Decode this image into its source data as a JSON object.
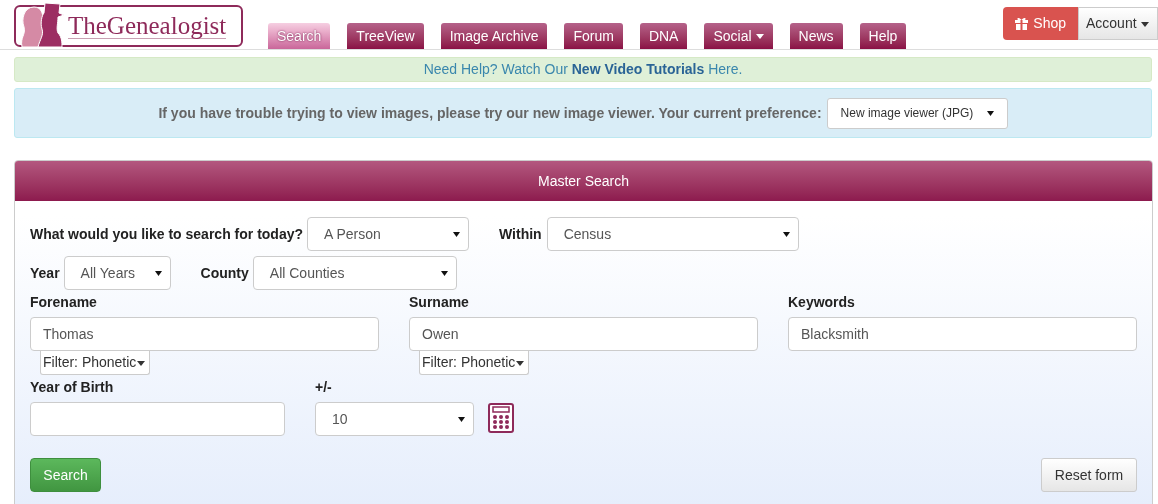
{
  "logo": {
    "text": "TheGenealogist"
  },
  "nav_tabs": [
    {
      "label": "Search",
      "selected": true,
      "caret": false
    },
    {
      "label": "TreeView",
      "selected": false,
      "caret": false
    },
    {
      "label": "Image Archive",
      "selected": false,
      "caret": false
    },
    {
      "label": "Forum",
      "selected": false,
      "caret": false
    },
    {
      "label": "DNA",
      "selected": false,
      "caret": false
    },
    {
      "label": "Social",
      "selected": false,
      "caret": true
    },
    {
      "label": "News",
      "selected": false,
      "caret": false
    },
    {
      "label": "Help",
      "selected": false,
      "caret": false
    }
  ],
  "shop_button": "Shop",
  "account_button": "Account",
  "help_banner": "Need Help? Watch Our **New Video Tutorials** Here.",
  "viewer_notice": {
    "text": "If you have trouble trying to view images, please try our new image viewer. Your current preference:",
    "value": "New image viewer (JPG)"
  },
  "panel": {
    "title": "Master Search",
    "search_for": {
      "label": "What would you like to search for today?",
      "value": "A Person"
    },
    "within": {
      "label": "Within",
      "value": "Census"
    },
    "year": {
      "label": "Year",
      "value": "All Years"
    },
    "county": {
      "label": "County",
      "value": "All Counties"
    },
    "name_fields": [
      {
        "label": "Forename",
        "value": "Thomas",
        "filter": "Filter: Phonetic"
      },
      {
        "label": "Surname",
        "value": "Owen",
        "filter": "Filter: Phonetic"
      },
      {
        "label": "Keywords",
        "value": "Blacksmith"
      }
    ],
    "year_of_birth": {
      "label": "Year of Birth"
    },
    "range": {
      "label": "+/-",
      "value": "10"
    },
    "search_button": "Search",
    "reset_button": "Reset form"
  }
}
